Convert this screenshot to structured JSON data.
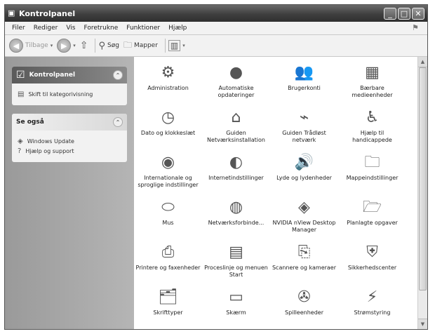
{
  "window": {
    "title": "Kontrolpanel"
  },
  "menu": [
    "Filer",
    "Rediger",
    "Vis",
    "Foretrukne",
    "Funktioner",
    "Hjælp"
  ],
  "toolbar": {
    "back_label": "Tilbage",
    "search_label": "Søg",
    "folders_label": "Mapper"
  },
  "sidebar": {
    "main_panel": {
      "title": "Kontrolpanel",
      "link": "Skift til kategorivisning"
    },
    "see_also": {
      "title": "Se også",
      "links": [
        "Windows Update",
        "Hjælp og support"
      ]
    }
  },
  "items": [
    {
      "label": "Administration",
      "icon": "administration-icon",
      "glyph": "⚙"
    },
    {
      "label": "Automatiske opdateringer",
      "icon": "automatic-updates-icon",
      "glyph": "●"
    },
    {
      "label": "Brugerkonti",
      "icon": "user-accounts-icon",
      "glyph": "👥"
    },
    {
      "label": "Bærbare medieenheder",
      "icon": "portable-media-icon",
      "glyph": "▦"
    },
    {
      "label": "Dato og klokkeslæt",
      "icon": "date-time-icon",
      "glyph": "◷"
    },
    {
      "label": "Guiden Netværksinstallation",
      "icon": "network-setup-icon",
      "glyph": "⌂"
    },
    {
      "label": "Guiden Trådløst netværk",
      "icon": "wireless-network-icon",
      "glyph": "⌁"
    },
    {
      "label": "Hjælp til handicappede",
      "icon": "accessibility-icon",
      "glyph": "♿"
    },
    {
      "label": "Internationale og sproglige indstillinger",
      "icon": "regional-language-icon",
      "glyph": "◉"
    },
    {
      "label": "Internetindstillinger",
      "icon": "internet-options-icon",
      "glyph": "◐"
    },
    {
      "label": "Lyde og lydenheder",
      "icon": "sounds-icon",
      "glyph": "🔊"
    },
    {
      "label": "Mappeindstillinger",
      "icon": "folder-options-icon",
      "glyph": "🗀"
    },
    {
      "label": "Mus",
      "icon": "mouse-icon",
      "glyph": "⬭"
    },
    {
      "label": "Netværksforbinde...",
      "icon": "network-connections-icon",
      "glyph": "◍"
    },
    {
      "label": "NVIDIA nView Desktop Manager",
      "icon": "nvidia-icon",
      "glyph": "◈"
    },
    {
      "label": "Planlagte opgaver",
      "icon": "scheduled-tasks-icon",
      "glyph": "🗁"
    },
    {
      "label": "Printere og faxenheder",
      "icon": "printers-icon",
      "glyph": "⎙"
    },
    {
      "label": "Proceslinje og menuen Start",
      "icon": "taskbar-start-icon",
      "glyph": "▤"
    },
    {
      "label": "Scannere og kameraer",
      "icon": "scanners-icon",
      "glyph": "⎘"
    },
    {
      "label": "Sikkerhedscenter",
      "icon": "security-center-icon",
      "glyph": "⛨"
    },
    {
      "label": "Skrifttyper",
      "icon": "fonts-icon",
      "glyph": "🗂"
    },
    {
      "label": "Skærm",
      "icon": "display-icon",
      "glyph": "▭"
    },
    {
      "label": "Spilleenheder",
      "icon": "game-controllers-icon",
      "glyph": "✇"
    },
    {
      "label": "Strømstyring",
      "icon": "power-options-icon",
      "glyph": "⚡"
    }
  ]
}
